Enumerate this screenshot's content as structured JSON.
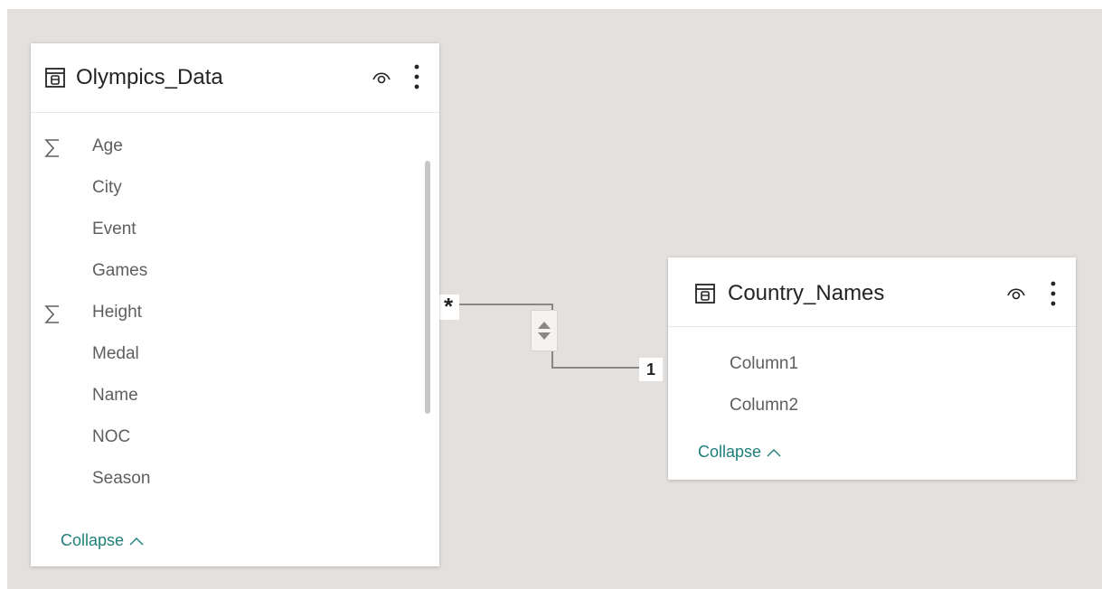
{
  "tables": [
    {
      "title": "Olympics_Data",
      "fields": [
        {
          "label": "Age",
          "aggregated": true
        },
        {
          "label": "City",
          "aggregated": false
        },
        {
          "label": "Event",
          "aggregated": false
        },
        {
          "label": "Games",
          "aggregated": false
        },
        {
          "label": "Height",
          "aggregated": true
        },
        {
          "label": "Medal",
          "aggregated": false
        },
        {
          "label": "Name",
          "aggregated": false
        },
        {
          "label": "NOC",
          "aggregated": false
        },
        {
          "label": "Season",
          "aggregated": false
        }
      ],
      "collapse_label": "Collapse"
    },
    {
      "title": "Country_Names",
      "fields": [
        {
          "label": "Column1",
          "aggregated": false
        },
        {
          "label": "Column2",
          "aggregated": false
        }
      ],
      "collapse_label": "Collapse"
    }
  ],
  "relationship": {
    "from_cardinality": "*",
    "to_cardinality": "1",
    "cross_filter": "both-directions"
  },
  "colors": {
    "canvas": "#e3e0dd",
    "accent": "#1e7f7a",
    "line": "#8a8886"
  },
  "icons": {
    "table": "table-icon",
    "visibility": "eye-icon",
    "more": "more-options-icon",
    "sum": "sigma-icon",
    "collapse": "chevron-up-icon"
  }
}
